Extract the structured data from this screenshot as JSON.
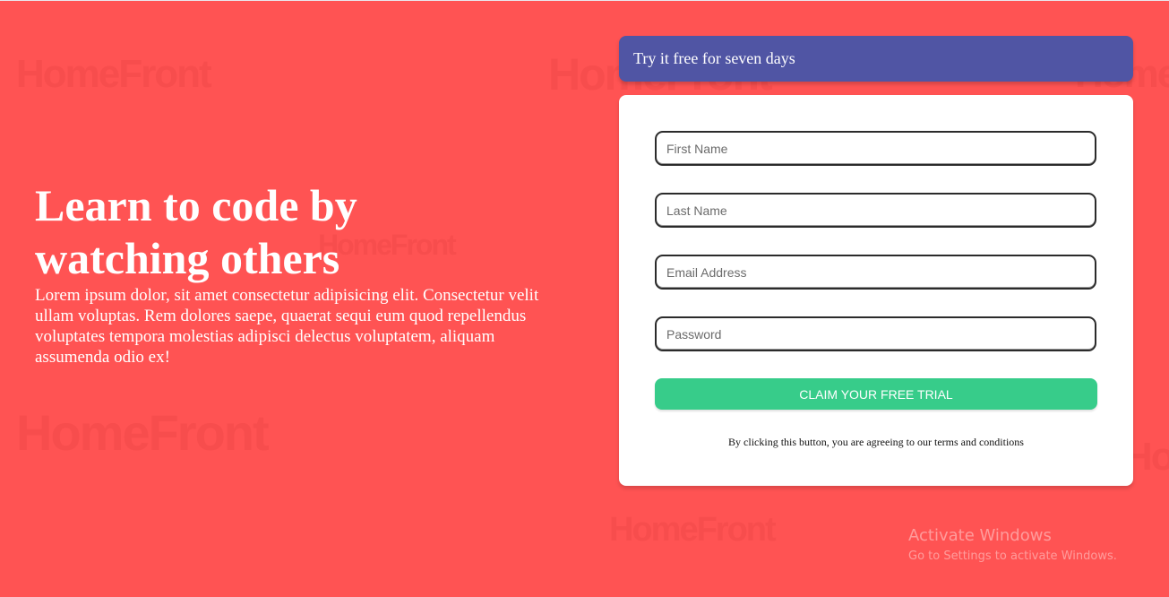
{
  "watermark": {
    "logo_text": "HomeFront"
  },
  "hero": {
    "heading_line1": "Learn to code by",
    "heading_line2": "watching others",
    "description": "Lorem ipsum dolor, sit amet consectetur adipisicing elit. Consectetur velit ullam voluptas. Rem dolores saepe, quaerat sequi eum quod repellendus voluptates tempora molestias adipisci delectus voluptatem, aliquam assumenda odio ex!"
  },
  "banner": {
    "text": "Try it free for seven days"
  },
  "form": {
    "first_name_placeholder": "First Name",
    "last_name_placeholder": "Last Name",
    "email_placeholder": "Email Address",
    "password_placeholder": "Password",
    "submit_label": "CLAIM YOUR FREE TRIAL",
    "terms_text": "By clicking this button, you are agreeing to our terms and conditions"
  },
  "os_overlay": {
    "title": "Activate Windows",
    "subtitle": "Go to Settings to activate Windows."
  },
  "colors": {
    "background": "#ff5353",
    "banner": "#5055a4",
    "button": "#37cc8a",
    "card": "#ffffff"
  }
}
